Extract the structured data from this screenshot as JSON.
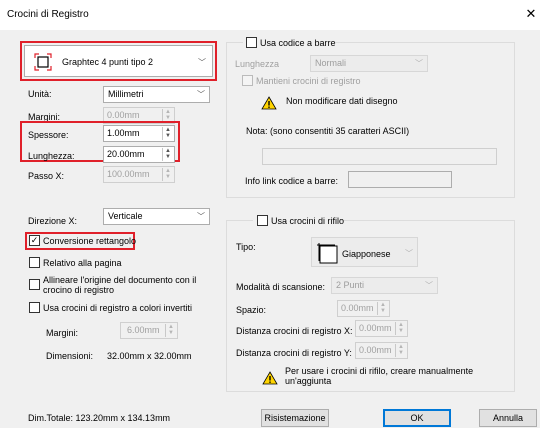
{
  "window": {
    "title": "Crocini di Registro",
    "close_glyph": "✕"
  },
  "mark_type": {
    "value": "Graphtec 4 punti tipo 2"
  },
  "units": {
    "label": "Unità:",
    "value": "Millimetri"
  },
  "margin": {
    "label": "Margini:",
    "value": "0.00mm"
  },
  "thickness": {
    "label": "Spessore:",
    "value": "1.00mm"
  },
  "length": {
    "label": "Lunghezza:",
    "value": "20.00mm"
  },
  "step_x": {
    "label": "Passo X:",
    "value": "100.00mm"
  },
  "direction_x": {
    "label": "Direzione X:",
    "value": "Verticale"
  },
  "options": {
    "rect_conversion": {
      "label": "Conversione rettangolo",
      "checked": true
    },
    "relative_page": {
      "label": "Relativo alla pagina",
      "checked": false
    },
    "align_origin": {
      "label_line1": "Allineare l'origine del documento con il",
      "label_line2": "crocino di registro",
      "checked": false
    },
    "inverted_colors": {
      "label": "Usa crocini di registro a colori invertiti",
      "checked": false
    }
  },
  "inverted": {
    "margin_label": "Margini:",
    "margin_value": "6.00mm",
    "size_label": "Dimensioni:",
    "size_value": "32.00mm x 32.00mm"
  },
  "barcode": {
    "use_label": "Usa codice a barre",
    "length_label": "Lunghezza",
    "length_value": "Normali",
    "keep_label": "Mantieni crocini di registro",
    "warning": "Non modificare dati disegno",
    "note": "Nota: (sono consentiti 35 caratteri ASCII)",
    "info_label": "Info link codice a barre:"
  },
  "trim": {
    "use_label": "Usa crocini di rifilo",
    "type_label": "Tipo:",
    "type_value": "Giapponese",
    "scan_label": "Modalità di scansione:",
    "scan_value": "2 Punti",
    "space_label": "Spazio:",
    "space_value": "0.00mm",
    "dist_x_label": "Distanza crocini di registro X:",
    "dist_x_value": "0.00mm",
    "dist_y_label": "Distanza crocini di registro Y:",
    "dist_y_value": "0.00mm",
    "note_line1": "Per usare i crocini di rifilo, creare manualmente",
    "note_line2": "un'aggiunta"
  },
  "footer": {
    "total": "Dim.Totale:   123.20mm x 134.13mm",
    "reset": "Risistemazione",
    "ok": "OK",
    "cancel": "Annulla"
  },
  "colors": {
    "highlight": "#e0202a",
    "default_button": "#0078d7"
  }
}
